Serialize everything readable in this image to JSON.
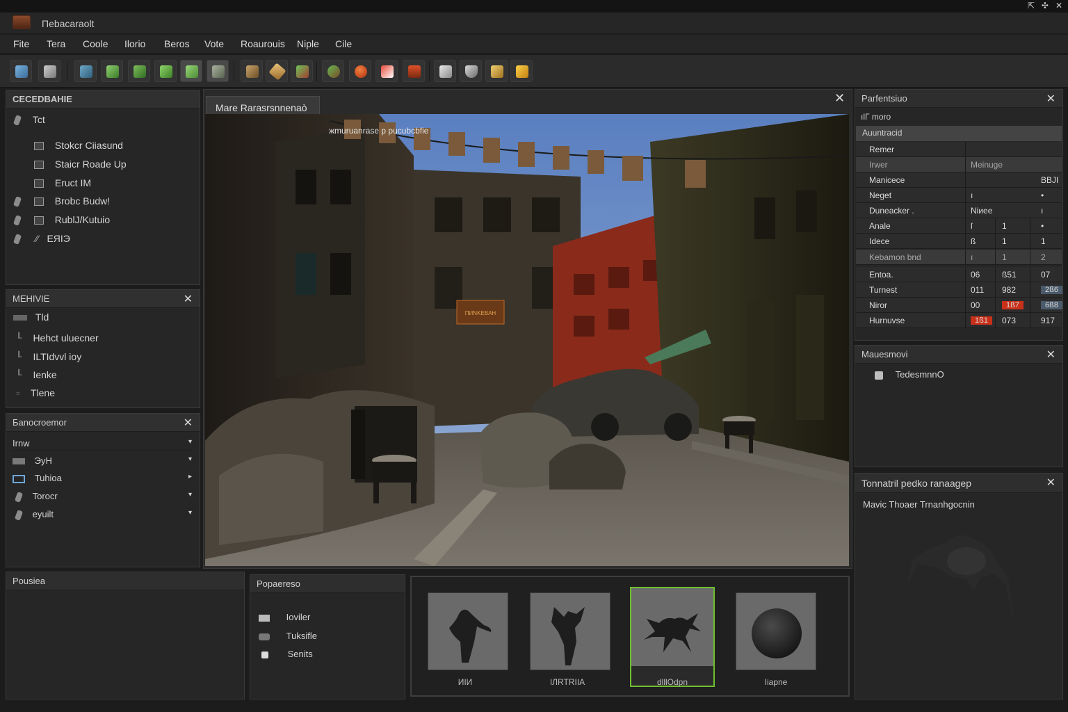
{
  "app": {
    "title": "Пebacaraolt"
  },
  "window_controls": [
    "⇱",
    "✣",
    "✕"
  ],
  "menu": [
    "Fite",
    "Tera",
    "Coole",
    "Ilorio",
    "Beros",
    "Vote",
    "Roaurouis",
    "Niple",
    "Cile"
  ],
  "toolbar": {
    "buttons": [
      "wrench-icon",
      "brush-icon",
      "cube-icon",
      "green-box-icon",
      "green-box-icon",
      "green-box-icon",
      "green-box-icon",
      "panel-icon",
      "crate-icon",
      "bandage-icon",
      "tree-icon",
      "character-icon",
      "red-sphere-icon",
      "red-hat-icon",
      "torii-icon",
      "paper-icon",
      "shield-icon",
      "crate-icon",
      "jar-icon"
    ]
  },
  "hierarchy_panel": {
    "title": "CЕCEDBAHIE",
    "root": "Tct",
    "items": [
      "Stokcr Ciiasund",
      "Staicr Roade Up",
      "Eruct IM",
      "Brobc Budw!",
      "RublJ/Kutuio",
      "EЯIЭ"
    ]
  },
  "materials_panel": {
    "title": "MEHIVIE",
    "root": "Tld",
    "items": [
      "Hehct uluecner",
      "ILTIdvvl ioy",
      "Ienke",
      "Tlene"
    ]
  },
  "lights_panel": {
    "title": "Бanocroemor",
    "header": "Irnw",
    "items": [
      "ЭyH",
      "Tuhioa",
      "Torocr",
      "eyuilt"
    ]
  },
  "bottom_left_panel": {
    "title": "Pousiea"
  },
  "properties_small_panel": {
    "title": "Popaereso",
    "items": [
      "Ioviler",
      "Tuksifle",
      "Senits"
    ]
  },
  "viewport": {
    "tab": "Mare Rarasrsnnenaò",
    "overlay_text": "жmuruanrase р рucubcbfie",
    "sign_text": "ПИNKEBAH"
  },
  "right_top_panel": {
    "title": "Parfentsiuo",
    "group1": "ılГ moro",
    "group2": "Auuntracid",
    "rows": [
      {
        "label": "Remer",
        "v1": "",
        "v2": "",
        "v3": "",
        "section": false
      },
      {
        "label": "Irwer",
        "v1": "Meinuge",
        "v2": "",
        "v3": "",
        "section": true
      },
      {
        "label": "Manicece",
        "v1": "",
        "v2": "",
        "v3": "BBJI",
        "section": false
      },
      {
        "label": "Neget",
        "v1": "ı",
        "v2": "",
        "v3": "•",
        "section": false
      },
      {
        "label": "Duneacker .",
        "v1": "Niиee",
        "v2": "",
        "v3": "ı",
        "section": false
      },
      {
        "label": "Anale",
        "v1": "ſ",
        "v2": "1",
        "v3": "•",
        "section": false
      },
      {
        "label": "Idece",
        "v1": "ß",
        "v2": "1",
        "v3": "1",
        "section": false
      },
      {
        "label": "Kebamon bnd",
        "v1": "ı",
        "v2": "1",
        "v3": "2",
        "section": true
      },
      {
        "label": "Entoa.",
        "v1": "06",
        "v2": "ß51",
        "v3": "07",
        "section": false
      },
      {
        "label": "Turnest",
        "v1": "011",
        "v2": "982",
        "v3": "2ß6",
        "section": false
      },
      {
        "label": "Niror",
        "v1": "00",
        "v2": "1ß7",
        "v3": "6ß8",
        "section": false
      },
      {
        "label": "Hurnuvse",
        "v1": "1ß1",
        "v2": "073",
        "v3": "917",
        "section": false
      }
    ]
  },
  "right_mid_panel": {
    "title": "Mauesmovi",
    "item": "TedesmnnO"
  },
  "right_bottom_panel": {
    "title": "Tonnatril pedko ranaagep",
    "subtitle": "Mavic Thoaer Trnanhgocnin"
  },
  "asset_browser": {
    "thumbs": [
      {
        "label": "ИIИ",
        "kind": "figure",
        "selected": false
      },
      {
        "label": "IЛRTRIIA",
        "kind": "figure2",
        "selected": false
      },
      {
        "label": "dlllOdpn",
        "kind": "creature",
        "selected": true
      },
      {
        "label": "Iiapne",
        "kind": "sphere",
        "selected": false
      }
    ]
  },
  "colors": {
    "accent_selected": "#6fbf2f",
    "bg_dark": "#1c1c1c",
    "panel": "#262626",
    "red_cell": "#c9301a"
  }
}
